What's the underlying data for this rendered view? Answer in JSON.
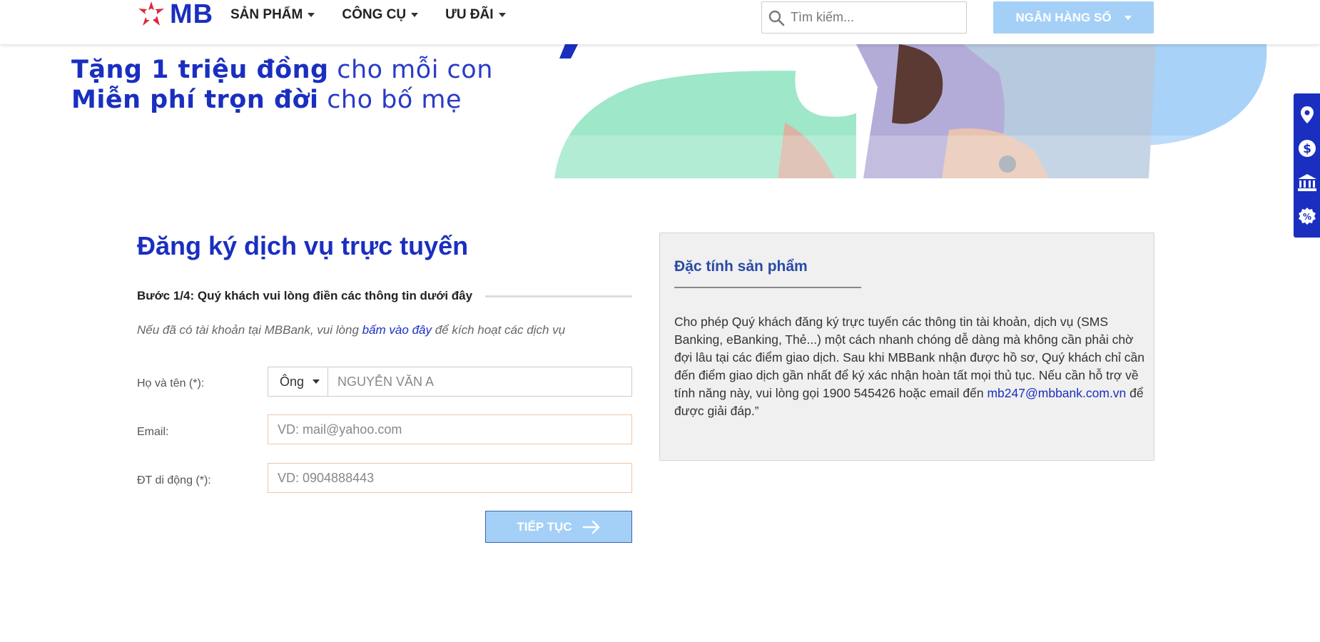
{
  "header": {
    "logo_text": "MB",
    "nav": [
      {
        "label": "SẢN PHẨM"
      },
      {
        "label": "CÔNG CỤ"
      },
      {
        "label": "ƯU ĐÃI"
      }
    ],
    "search_placeholder": "Tìm kiếm...",
    "digital_banking_label": "NGÂN HÀNG SỐ"
  },
  "banner": {
    "line1_bold": "Tặng 1 triệu đồng",
    "line1_light": " cho mỗi con",
    "line2_bold": "Miễn phí trọn đời",
    "line2_light": " cho bố mẹ"
  },
  "side_tools": [
    "location-icon",
    "dollar-icon",
    "bank-icon",
    "discount-icon"
  ],
  "form": {
    "title": "Đăng ký dịch vụ trực tuyến",
    "step": "Bước 1/4: Quý khách vui lòng điền các thông tin dưới đây",
    "hint_before": "Nếu đã có tài khoản tại MBBank, vui lòng ",
    "hint_link": "bấm vào đây",
    "hint_after": " để kích hoạt các dịch vụ",
    "name_label": "Họ và tên (*):",
    "salutation": "Ông",
    "name_placeholder": "NGUYỄN VĂN A",
    "email_label": "Email:",
    "email_placeholder": "VD: mail@yahoo.com",
    "phone_label": "ĐT di động (*):",
    "phone_placeholder": "VD: 0904888443",
    "continue_label": "TIẾP TỤC"
  },
  "features": {
    "title": "Đặc tính sản phẩm",
    "body_before": "Cho phép Quý khách đăng ký trực tuyến các thông tin tài khoản, dịch vụ (SMS Banking, eBanking, Thẻ...) một cách nhanh chóng dễ dàng mà không cần phải chờ đợi lâu tại các điểm giao dịch. Sau khi MBBank nhận được hồ sơ, Quý khách chỉ cần đến điểm giao dịch gần nhất để ký xác nhận hoàn tất mọi thủ tục. Nếu cần hỗ trợ về tính năng này, vui lòng gọi 1900 545426 hoặc email đến ",
    "email_link": "mb247@mbbank.com.vn",
    "body_after": " để được giải đáp.”"
  },
  "colors": {
    "brand_blue": "#1a2fc0",
    "light_button": "#a4d0f7",
    "logo_red": "#e0283a"
  }
}
